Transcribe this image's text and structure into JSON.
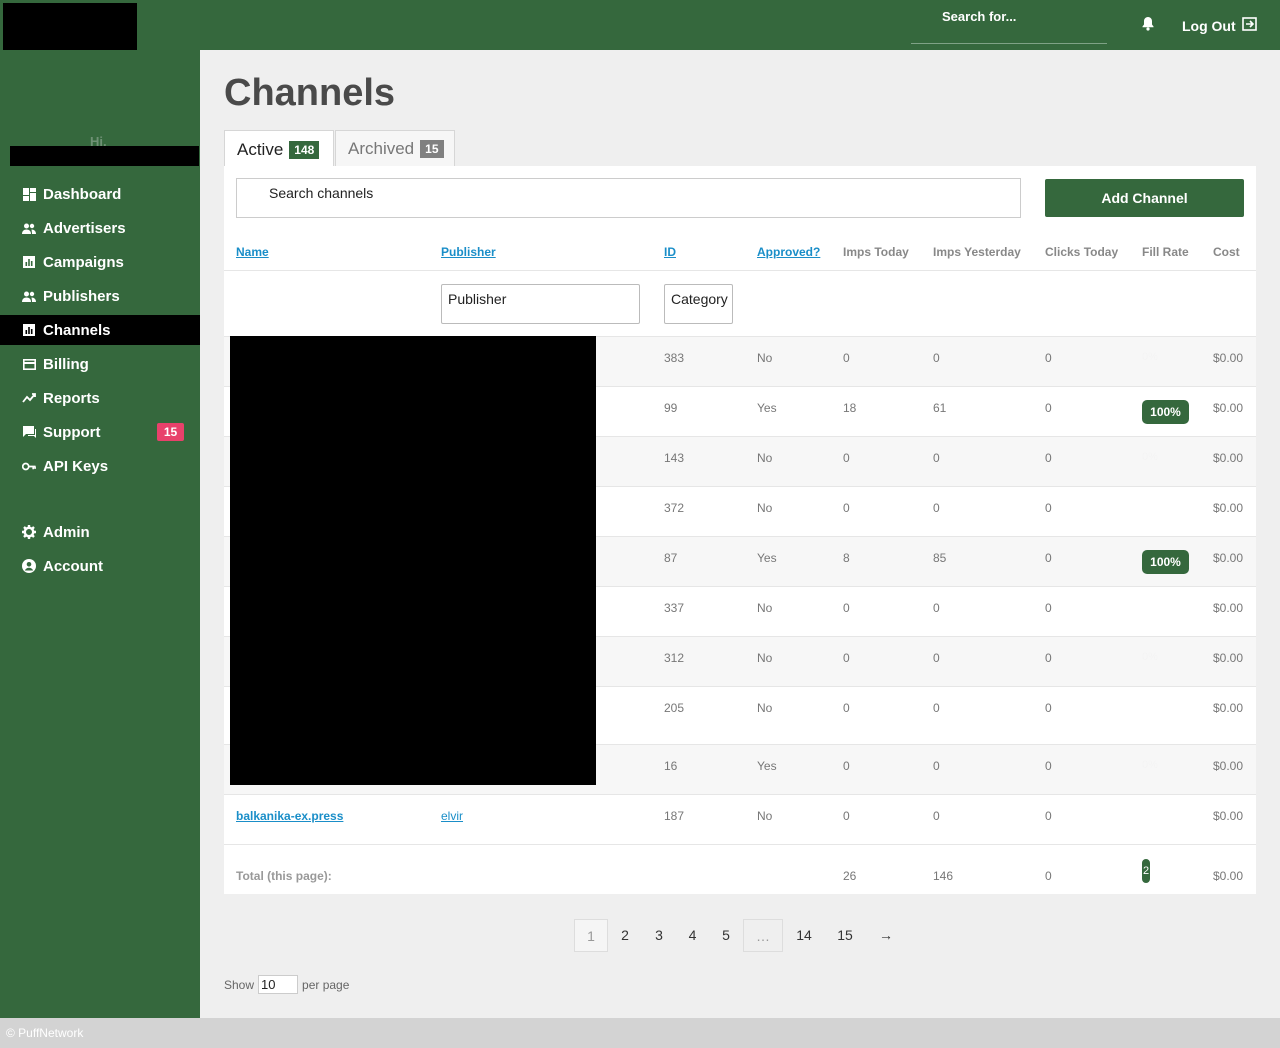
{
  "header": {
    "search_placeholder": "Search for...",
    "logout_label": "Log Out"
  },
  "sidebar": {
    "greeting": "Hi,",
    "items": [
      {
        "label": "Dashboard",
        "icon": "dashboard-icon"
      },
      {
        "label": "Advertisers",
        "icon": "users-icon"
      },
      {
        "label": "Campaigns",
        "icon": "chart-icon"
      },
      {
        "label": "Publishers",
        "icon": "users-icon"
      },
      {
        "label": "Channels",
        "icon": "chart-icon"
      },
      {
        "label": "Billing",
        "icon": "credit-card-icon"
      },
      {
        "label": "Reports",
        "icon": "trend-icon"
      },
      {
        "label": "Support",
        "icon": "chat-icon",
        "badge": "15"
      },
      {
        "label": "API Keys",
        "icon": "key-icon"
      },
      {
        "label": "Admin",
        "icon": "gear-icon"
      },
      {
        "label": "Account",
        "icon": "user-circle-icon"
      }
    ],
    "active": "Channels"
  },
  "page": {
    "title": "Channels",
    "tabs": [
      {
        "label": "Active",
        "count": "148"
      },
      {
        "label": "Archived",
        "count": "15"
      }
    ],
    "search_placeholder": "Search channels",
    "add_button": "Add Channel"
  },
  "table": {
    "columns": [
      "Name",
      "Publisher",
      "ID",
      "Approved?",
      "Imps Today",
      "Imps Yesterday",
      "Clicks Today",
      "Fill Rate",
      "Cost"
    ],
    "filters": {
      "publisher": "Publisher",
      "category": "Category"
    },
    "rows": [
      {
        "name": "",
        "publisher": "",
        "id": "383",
        "approved": "No",
        "imps_today": "0",
        "imps_yesterday": "0",
        "clicks_today": "0",
        "fill_rate": "0%",
        "cost": "$0.00"
      },
      {
        "name": "",
        "publisher": "",
        "id": "99",
        "approved": "Yes",
        "imps_today": "18",
        "imps_yesterday": "61",
        "clicks_today": "0",
        "fill_rate": "100%",
        "cost": "$0.00"
      },
      {
        "name": "",
        "publisher": "",
        "id": "143",
        "approved": "No",
        "imps_today": "0",
        "imps_yesterday": "0",
        "clicks_today": "0",
        "fill_rate": "0%",
        "cost": "$0.00"
      },
      {
        "name": "",
        "publisher": "",
        "id": "372",
        "approved": "No",
        "imps_today": "0",
        "imps_yesterday": "0",
        "clicks_today": "0",
        "fill_rate": "",
        "cost": "$0.00"
      },
      {
        "name": "",
        "publisher": "",
        "id": "87",
        "approved": "Yes",
        "imps_today": "8",
        "imps_yesterday": "85",
        "clicks_today": "0",
        "fill_rate": "100%",
        "cost": "$0.00"
      },
      {
        "name": "",
        "publisher": "",
        "id": "337",
        "approved": "No",
        "imps_today": "0",
        "imps_yesterday": "0",
        "clicks_today": "0",
        "fill_rate": "",
        "cost": "$0.00"
      },
      {
        "name": "",
        "publisher": "",
        "id": "312",
        "approved": "No",
        "imps_today": "0",
        "imps_yesterday": "0",
        "clicks_today": "0",
        "fill_rate": "0%",
        "cost": "$0.00"
      },
      {
        "name": "",
        "publisher": "",
        "id": "205",
        "approved": "No",
        "imps_today": "0",
        "imps_yesterday": "0",
        "clicks_today": "0",
        "fill_rate": "",
        "cost": "$0.00"
      },
      {
        "name": "",
        "publisher": "",
        "id": "16",
        "approved": "Yes",
        "imps_today": "0",
        "imps_yesterday": "0",
        "clicks_today": "0",
        "fill_rate": "0%",
        "cost": "$0.00"
      },
      {
        "name": "balkanika-ex.press",
        "publisher": "elvir",
        "id": "187",
        "approved": "No",
        "imps_today": "0",
        "imps_yesterday": "0",
        "clicks_today": "0",
        "fill_rate": "",
        "cost": "$0.00"
      }
    ],
    "total": {
      "label": "Total (this page):",
      "imps_today": "26",
      "imps_yesterday": "146",
      "clicks_today": "0",
      "fill_rate": "2",
      "cost": "$0.00"
    }
  },
  "pagination": {
    "pages": [
      "1",
      "2",
      "3",
      "4",
      "5",
      "…",
      "14",
      "15",
      "→"
    ],
    "current": "1"
  },
  "per_page": {
    "show_label": "Show",
    "value": "10",
    "suffix": "per page"
  },
  "footer": {
    "text": "© PuffNetwork"
  },
  "colors": {
    "brand": "#35683d",
    "link": "#1a8ec8",
    "badge": "#e8416b"
  }
}
